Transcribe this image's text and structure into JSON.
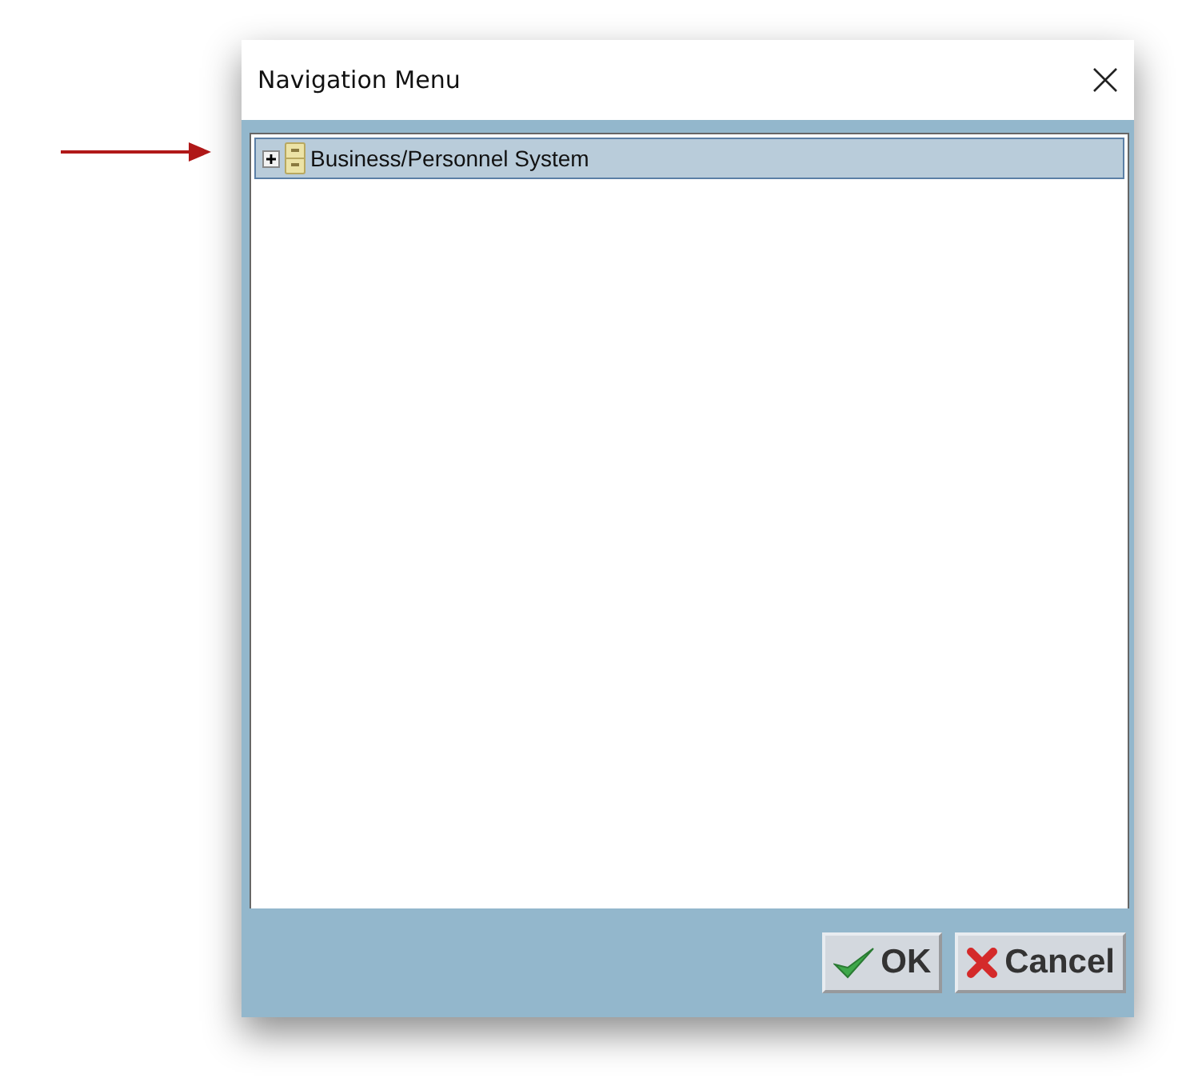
{
  "window": {
    "title": "Navigation Menu"
  },
  "tree": [
    {
      "label": "Business/Personnel System",
      "expanded": false,
      "selected": true
    }
  ],
  "buttons": [
    {
      "label": "OK",
      "kind": "ok"
    },
    {
      "label": "Cancel",
      "kind": "cancel"
    }
  ]
}
